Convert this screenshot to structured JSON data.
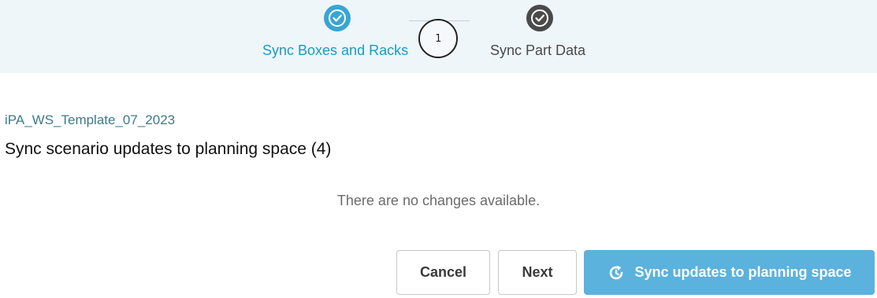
{
  "stepper": {
    "steps": [
      {
        "label": "Sync Boxes and Racks",
        "icon": "check-circle-icon",
        "state": "active",
        "color": "#3aa5d3"
      },
      {
        "label": "Sync Part Data",
        "icon": "check-circle-icon",
        "state": "inactive",
        "color": "#4a4a4a"
      }
    ],
    "annotation_marker": "1"
  },
  "main": {
    "scenario_name": "iPA_WS_Template_07_2023",
    "title": "Sync scenario updates to planning space (4)",
    "empty_message": "There are no changes available."
  },
  "actions": {
    "cancel_label": "Cancel",
    "next_label": "Next",
    "sync_label": "Sync updates to planning space",
    "sync_icon": "sync-icon"
  },
  "colors": {
    "header_background": "#eef6f9",
    "accent": "#1a9bc4",
    "primary_button": "#5ab2dd",
    "scenario_text": "#3c7a8a"
  }
}
